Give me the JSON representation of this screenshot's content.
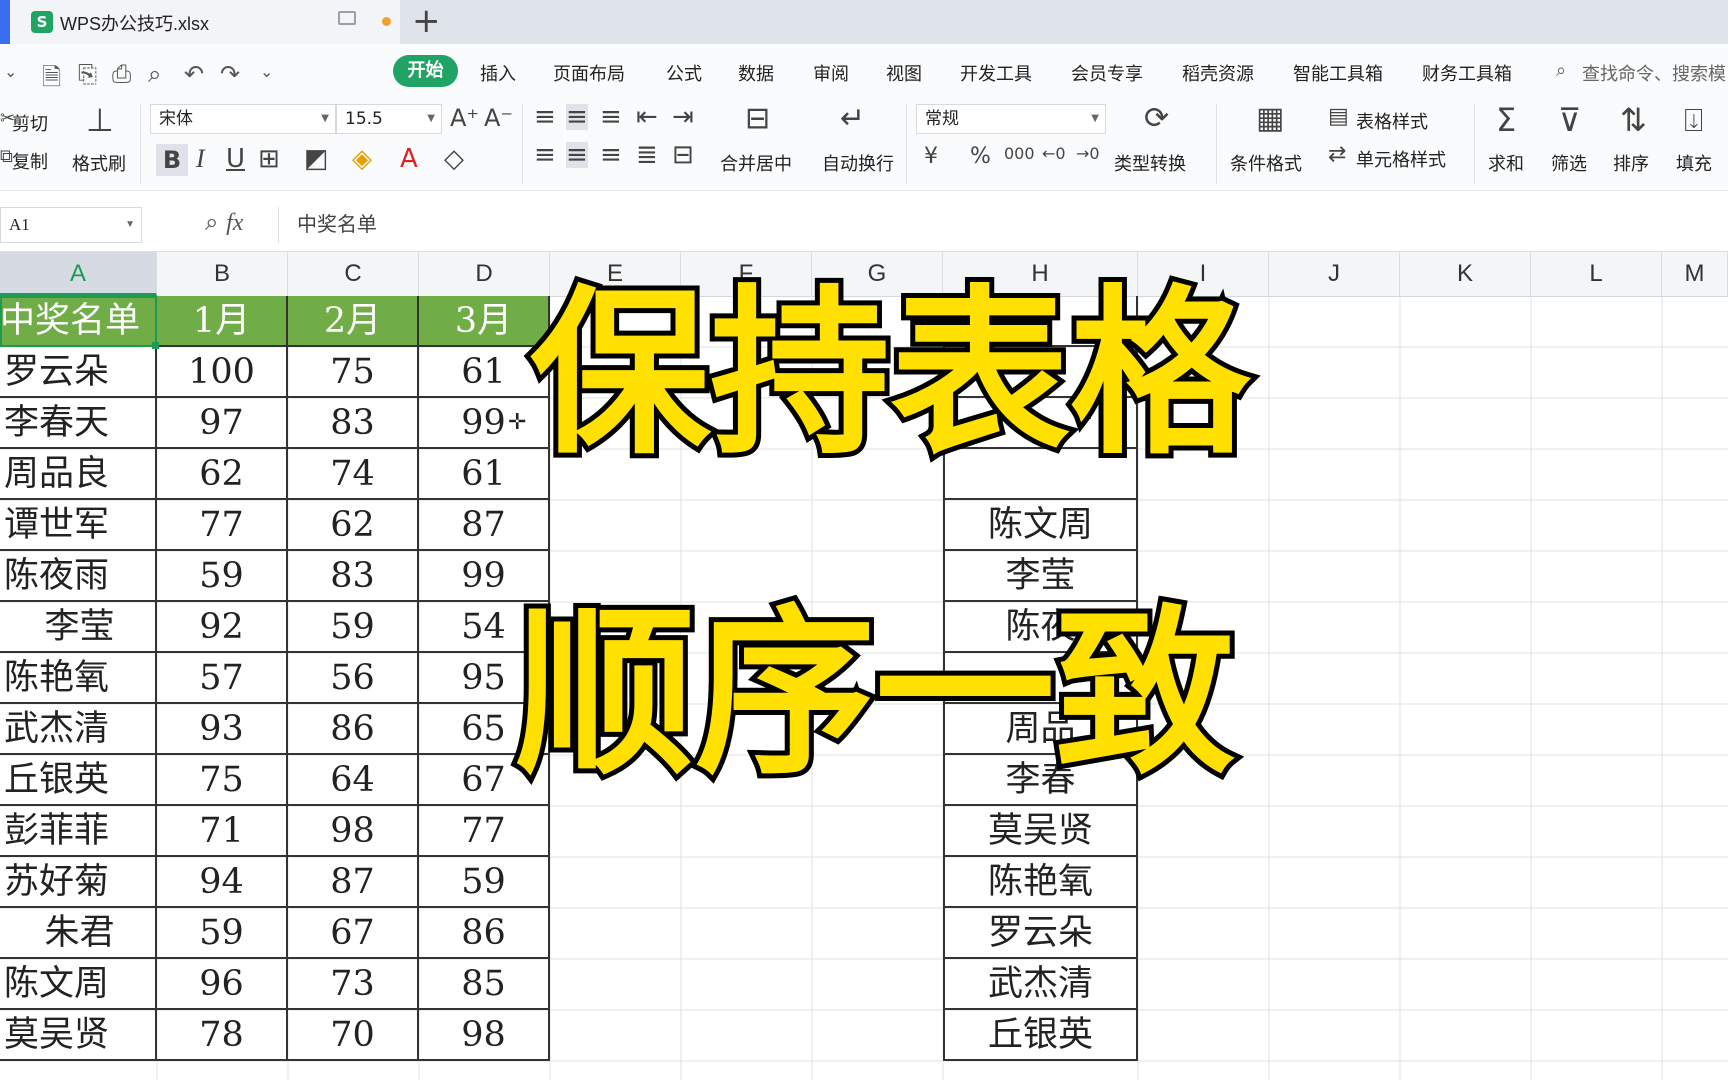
{
  "window": {
    "file_name": "WPS办公技巧.xlsx",
    "new_tab": "+"
  },
  "menu": {
    "items": [
      "开始",
      "插入",
      "页面布局",
      "公式",
      "数据",
      "审阅",
      "视图",
      "开发工具",
      "会员专享",
      "稻壳资源",
      "智能工具箱",
      "财务工具箱"
    ],
    "search": "查找命令、搜索模"
  },
  "ribbon": {
    "cut": "剪切",
    "copy": "复制",
    "format_painter": "格式刷",
    "font_name": "宋体",
    "font_size": "15.5",
    "merge_center": "合并居中",
    "wrap_text": "自动换行",
    "number_format": "常规",
    "type_convert": "类型转换",
    "conditional_format": "条件格式",
    "table_style": "表格样式",
    "cell_style": "单元格样式",
    "sum": "求和",
    "filter": "筛选",
    "sort": "排序",
    "fill": "填充",
    "bold": "B",
    "italic": "I",
    "underline": "U",
    "font_color": "A",
    "currency": "¥",
    "percent": "%",
    "thousands": "000"
  },
  "formula_bar": {
    "cell_ref": "A1",
    "fx": "fx",
    "content": "中奖名单"
  },
  "columns": [
    "A",
    "B",
    "C",
    "D",
    "E",
    "F",
    "G",
    "H",
    "I",
    "J",
    "K",
    "L",
    "M"
  ],
  "table_main": {
    "headers": [
      "中奖名单",
      "1月",
      "2月",
      "3月"
    ],
    "rows": [
      [
        "罗云朵",
        "100",
        "75",
        "61"
      ],
      [
        "李春天",
        "97",
        "83",
        "99"
      ],
      [
        "周品良",
        "62",
        "74",
        "61"
      ],
      [
        "谭世军",
        "77",
        "62",
        "87"
      ],
      [
        "陈夜雨",
        "59",
        "83",
        "99"
      ],
      [
        "李莹",
        "92",
        "59",
        "54"
      ],
      [
        "陈艳氧",
        "57",
        "56",
        "95"
      ],
      [
        "武杰清",
        "93",
        "86",
        "65"
      ],
      [
        "丘银英",
        "75",
        "64",
        "67"
      ],
      [
        "彭菲菲",
        "71",
        "98",
        "77"
      ],
      [
        "苏好菊",
        "94",
        "87",
        "59"
      ],
      [
        "朱君",
        "59",
        "67",
        "86"
      ],
      [
        "陈文周",
        "96",
        "73",
        "85"
      ],
      [
        "莫吴贤",
        "78",
        "70",
        "98"
      ]
    ]
  },
  "table_h": {
    "rows": [
      "",
      "",
      "",
      "",
      "陈文周",
      "李莹",
      "陈夜",
      "",
      "周品",
      "李春",
      "莫吴贤",
      "陈艳氧",
      "罗云朵",
      "武杰清",
      "丘银英"
    ]
  },
  "overlay": {
    "line1": "保持表格",
    "line2": "顺序一致"
  },
  "colors": {
    "header_green": "#70ad47",
    "accent_green": "#21a366",
    "overlay_yellow": "#ffe000"
  }
}
